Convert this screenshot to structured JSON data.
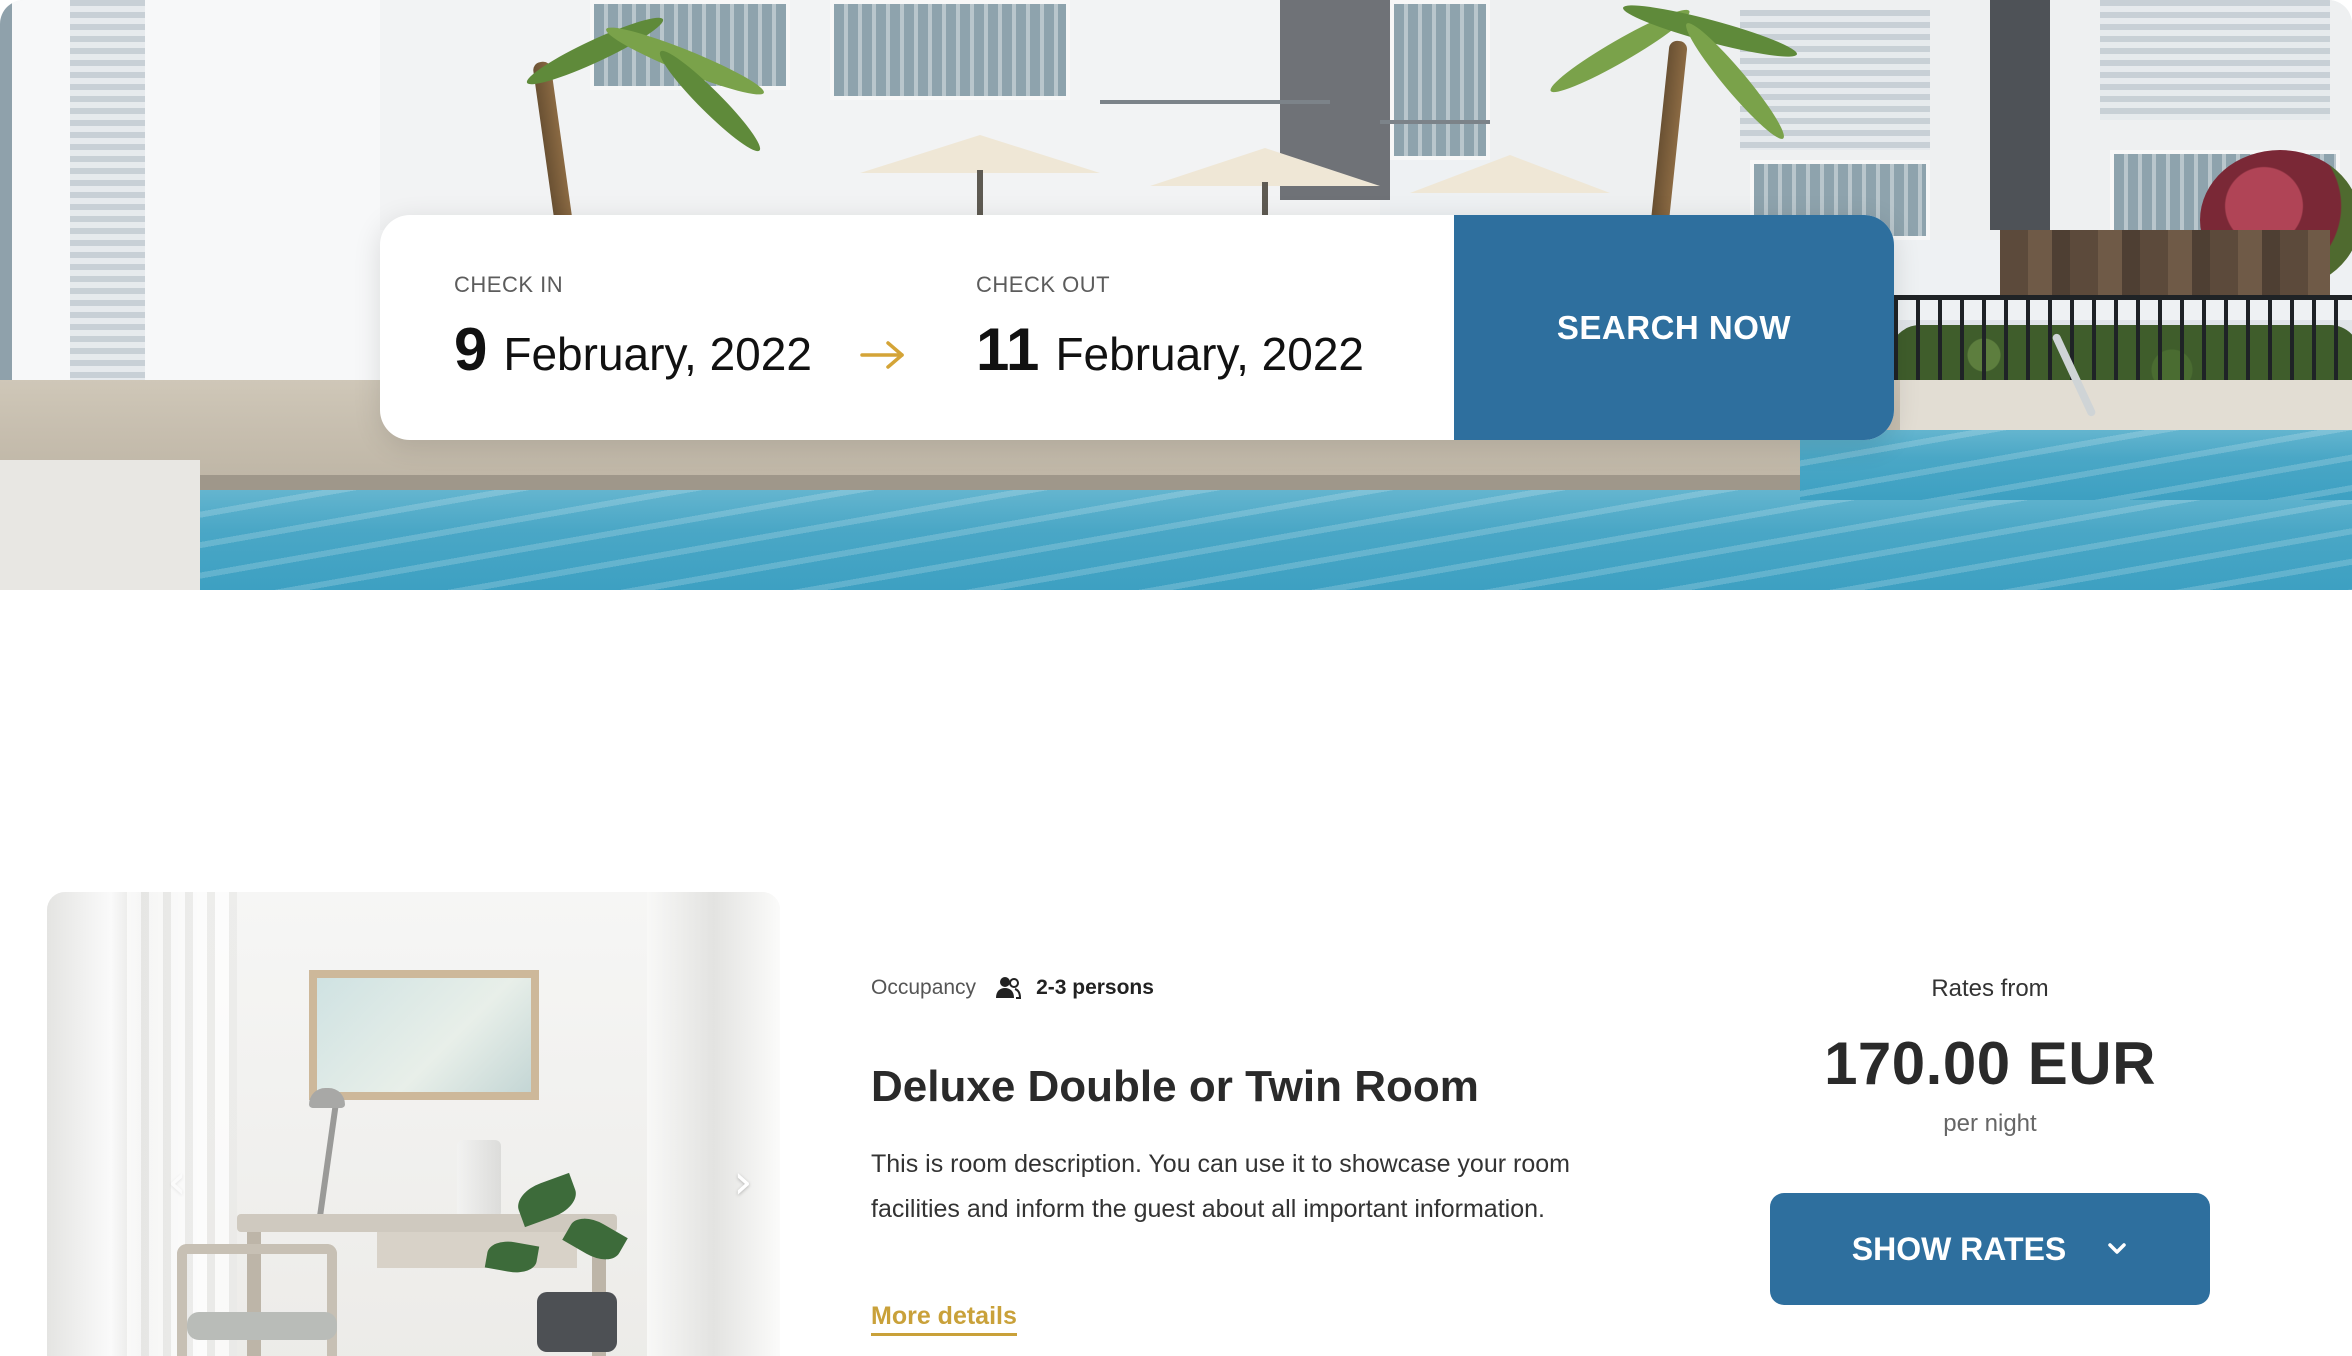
{
  "booking": {
    "check_in": {
      "label": "CHECK IN",
      "day": "9",
      "month_year": "February, 2022"
    },
    "check_out": {
      "label": "CHECK OUT",
      "day": "11",
      "month_year": "February, 2022"
    },
    "arrow_icon": "arrow-right-icon",
    "search_label": "SEARCH NOW"
  },
  "room": {
    "occupancy_label": "Occupancy",
    "occupancy_icon": "persons-icon",
    "occupancy_value": "2-3 persons",
    "title": "Deluxe Double or Twin Room",
    "description": "This is room description. You can use it to showcase your room facilities and inform the guest about all important information.",
    "more_details": "More details",
    "carousel_prev_icon": "chevron-left-icon",
    "carousel_next_icon": "chevron-right-icon"
  },
  "rates": {
    "label": "Rates from",
    "price": "170.00 EUR",
    "period": "per night",
    "button_label": "SHOW RATES",
    "button_icon": "chevron-down-icon"
  },
  "colors": {
    "primary_blue": "#2e6f9e",
    "accent_gold": "#c9a13a",
    "arrow_gold": "#d4a437"
  }
}
